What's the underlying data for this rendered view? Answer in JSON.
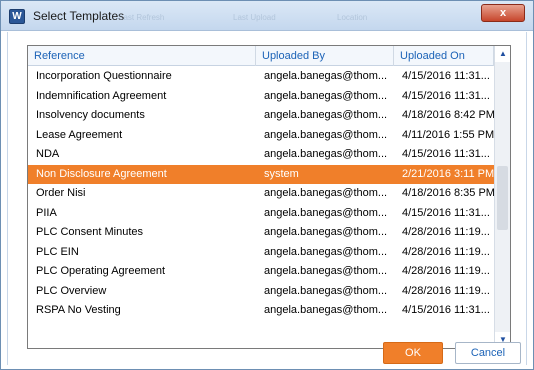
{
  "window": {
    "title": "Select Templates",
    "app_icon": "W",
    "close_label": "x",
    "ghost_labels": [
      "Last Refresh",
      "Last Upload",
      "Location"
    ]
  },
  "grid": {
    "columns": [
      "Reference",
      "Uploaded By",
      "Uploaded On"
    ],
    "rows": [
      {
        "reference": "Incorporation Questionnaire",
        "uploaded_by": "angela.banegas@thom...",
        "uploaded_on": "4/15/2016 11:31..."
      },
      {
        "reference": "Indemnification Agreement",
        "uploaded_by": "angela.banegas@thom...",
        "uploaded_on": "4/15/2016 11:31..."
      },
      {
        "reference": "Insolvency documents",
        "uploaded_by": "angela.banegas@thom...",
        "uploaded_on": "4/18/2016 8:42 PM"
      },
      {
        "reference": "Lease Agreement",
        "uploaded_by": "angela.banegas@thom...",
        "uploaded_on": "4/11/2016 1:55 PM"
      },
      {
        "reference": "NDA",
        "uploaded_by": "angela.banegas@thom...",
        "uploaded_on": "4/15/2016 11:31..."
      },
      {
        "reference": "Non Disclosure Agreement",
        "uploaded_by": "system",
        "uploaded_on": "2/21/2016 3:11 PM",
        "selected": true
      },
      {
        "reference": "Order Nisi",
        "uploaded_by": "angela.banegas@thom...",
        "uploaded_on": "4/18/2016 8:35 PM"
      },
      {
        "reference": "PIIA",
        "uploaded_by": "angela.banegas@thom...",
        "uploaded_on": "4/15/2016 11:31..."
      },
      {
        "reference": "PLC Consent Minutes",
        "uploaded_by": "angela.banegas@thom...",
        "uploaded_on": "4/28/2016 11:19..."
      },
      {
        "reference": "PLC EIN",
        "uploaded_by": "angela.banegas@thom...",
        "uploaded_on": "4/28/2016 11:19..."
      },
      {
        "reference": "PLC Operating Agreement",
        "uploaded_by": "angela.banegas@thom...",
        "uploaded_on": "4/28/2016 11:19..."
      },
      {
        "reference": "PLC Overview",
        "uploaded_by": "angela.banegas@thom...",
        "uploaded_on": "4/28/2016 11:19..."
      },
      {
        "reference": "RSPA No Vesting",
        "uploaded_by": "angela.banegas@thom...",
        "uploaded_on": "4/15/2016 11:31..."
      }
    ]
  },
  "scrollbar": {
    "up_icon": "▲",
    "down_icon": "▼"
  },
  "buttons": {
    "ok": "OK",
    "cancel": "Cancel"
  },
  "colors": {
    "selection": "#f07f2a",
    "header_text": "#1c63b7",
    "close": "#c7462c"
  }
}
